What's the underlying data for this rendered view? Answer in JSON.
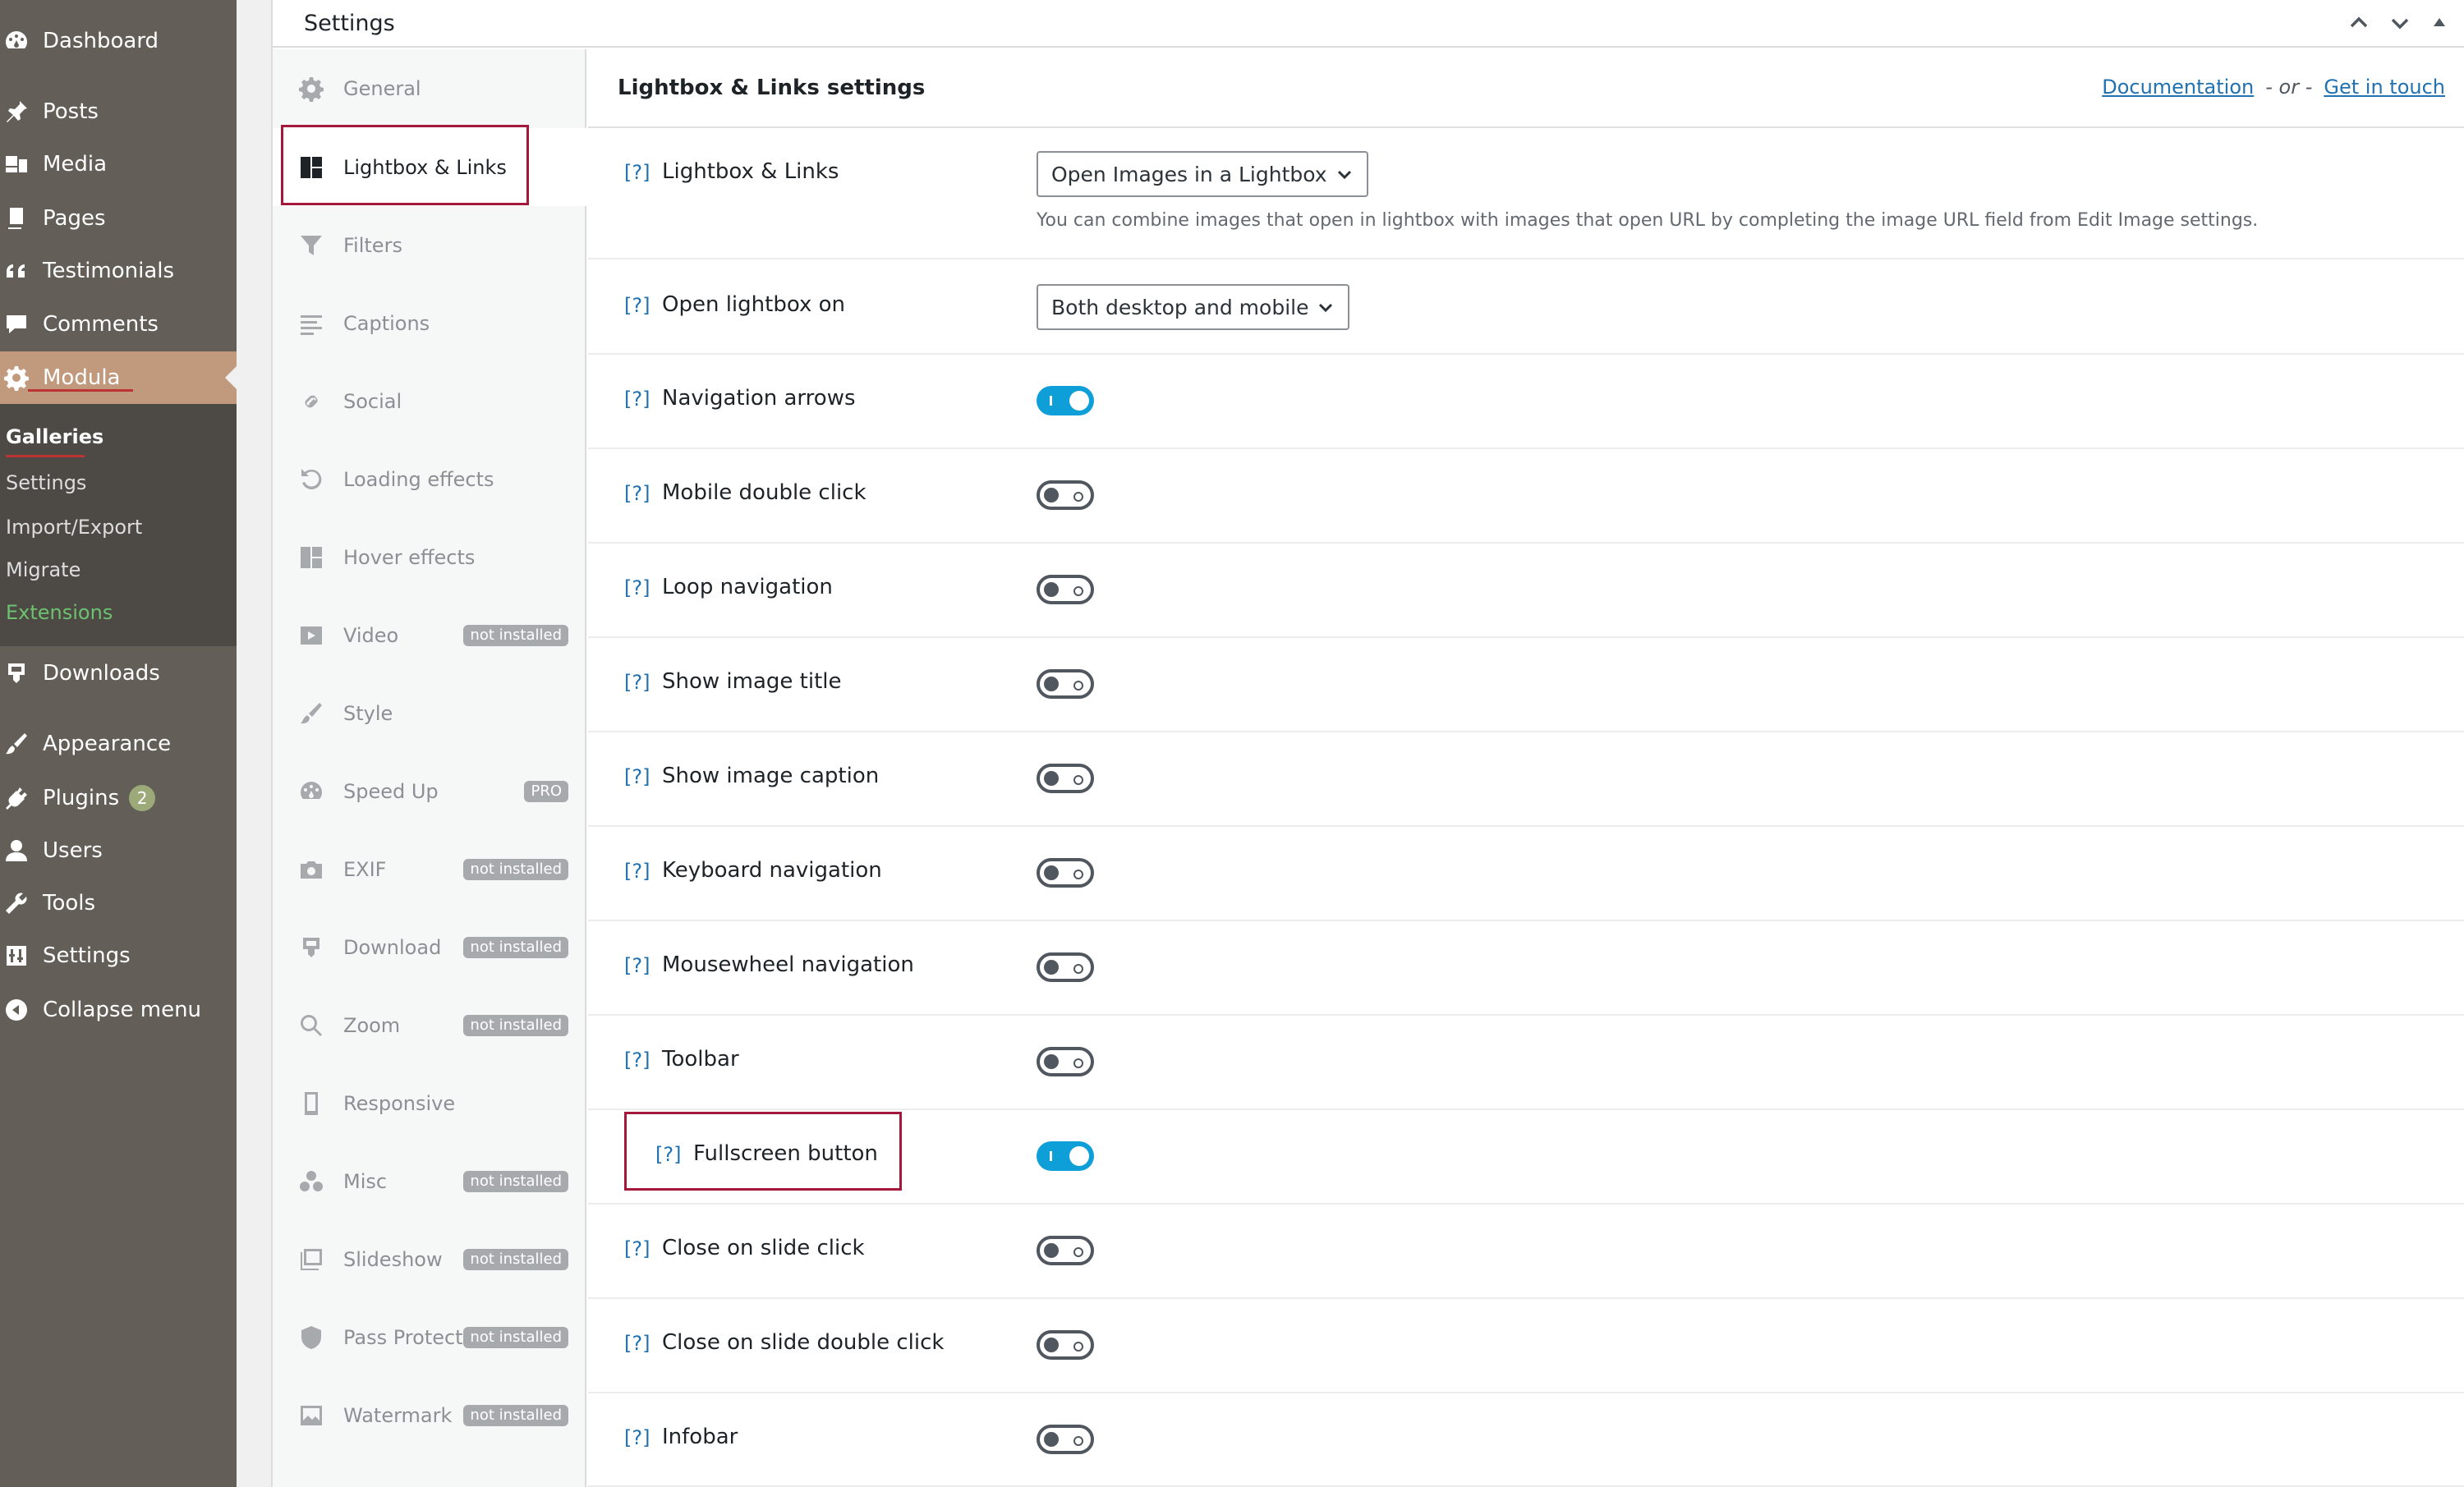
{
  "admin_menu": {
    "items": [
      {
        "label": "Dashboard",
        "icon": "dashboard-icon"
      },
      {
        "label": "Posts",
        "icon": "pin-icon"
      },
      {
        "label": "Media",
        "icon": "media-icon"
      },
      {
        "label": "Pages",
        "icon": "pages-icon"
      },
      {
        "label": "Testimonials",
        "icon": "quote-icon"
      },
      {
        "label": "Comments",
        "icon": "comment-icon"
      },
      {
        "label": "Modula",
        "icon": "gear-icon"
      },
      {
        "label": "Downloads",
        "icon": "download-icon"
      },
      {
        "label": "Appearance",
        "icon": "brush-icon"
      },
      {
        "label": "Plugins",
        "icon": "plug-icon",
        "badge": "2"
      },
      {
        "label": "Users",
        "icon": "user-icon"
      },
      {
        "label": "Tools",
        "icon": "wrench-icon"
      },
      {
        "label": "Settings",
        "icon": "settings-icon"
      },
      {
        "label": "Collapse menu",
        "icon": "collapse-icon"
      }
    ],
    "submenu": [
      "Galleries",
      "Settings",
      "Import/Export",
      "Migrate",
      "Extensions"
    ]
  },
  "panel": {
    "title": "Settings"
  },
  "tabs": [
    {
      "label": "General",
      "icon": "gear-icon"
    },
    {
      "label": "Lightbox & Links",
      "icon": "layout-icon"
    },
    {
      "label": "Filters",
      "icon": "filter-icon"
    },
    {
      "label": "Captions",
      "icon": "text-icon"
    },
    {
      "label": "Social",
      "icon": "link-icon"
    },
    {
      "label": "Loading effects",
      "icon": "refresh-icon"
    },
    {
      "label": "Hover effects",
      "icon": "layout-icon"
    },
    {
      "label": "Video",
      "icon": "video-icon",
      "tag": "not installed"
    },
    {
      "label": "Style",
      "icon": "brush-icon"
    },
    {
      "label": "Speed Up",
      "icon": "dashboard-icon",
      "tag": "PRO"
    },
    {
      "label": "EXIF",
      "icon": "camera-icon",
      "tag": "not installed"
    },
    {
      "label": "Download",
      "icon": "download-icon",
      "tag": "not installed"
    },
    {
      "label": "Zoom",
      "icon": "search-icon",
      "tag": "not installed"
    },
    {
      "label": "Responsive",
      "icon": "phone-icon"
    },
    {
      "label": "Misc",
      "icon": "circles-icon",
      "tag": "not installed"
    },
    {
      "label": "Slideshow",
      "icon": "images-icon",
      "tag": "not installed"
    },
    {
      "label": "Pass Protect",
      "icon": "shield-icon",
      "tag": "not installed"
    },
    {
      "label": "Watermark",
      "icon": "picture-icon",
      "tag": "not installed"
    }
  ],
  "content": {
    "title": "Lightbox & Links settings",
    "doc_link": "Documentation",
    "or_text": "- or -",
    "touch_link": "Get in touch",
    "help": "[?]",
    "rows": [
      {
        "label": "Lightbox & Links",
        "type": "select",
        "value": "Open Images in a Lightbox",
        "desc": "You can combine images that open in lightbox with images that open URL by completing the image URL field from Edit Image settings."
      },
      {
        "label": "Open lightbox on",
        "type": "select",
        "value": "Both desktop and mobile"
      },
      {
        "label": "Navigation arrows",
        "type": "toggle",
        "on": true
      },
      {
        "label": "Mobile double click",
        "type": "toggle",
        "on": false
      },
      {
        "label": "Loop navigation",
        "type": "toggle",
        "on": false
      },
      {
        "label": "Show image title",
        "type": "toggle",
        "on": false
      },
      {
        "label": "Show image caption",
        "type": "toggle",
        "on": false
      },
      {
        "label": "Keyboard navigation",
        "type": "toggle",
        "on": false
      },
      {
        "label": "Mousewheel navigation",
        "type": "toggle",
        "on": false
      },
      {
        "label": "Toolbar",
        "type": "toggle",
        "on": false
      },
      {
        "label": "Fullscreen button",
        "type": "toggle",
        "on": true
      },
      {
        "label": "Close on slide click",
        "type": "toggle",
        "on": false
      },
      {
        "label": "Close on slide double click",
        "type": "toggle",
        "on": false
      },
      {
        "label": "Infobar",
        "type": "toggle",
        "on": false
      }
    ]
  },
  "colors": {
    "sidebar": "#635f58",
    "accent": "#c19a7e",
    "toggle_on": "#0e9fd9",
    "highlight": "#a3183b"
  }
}
